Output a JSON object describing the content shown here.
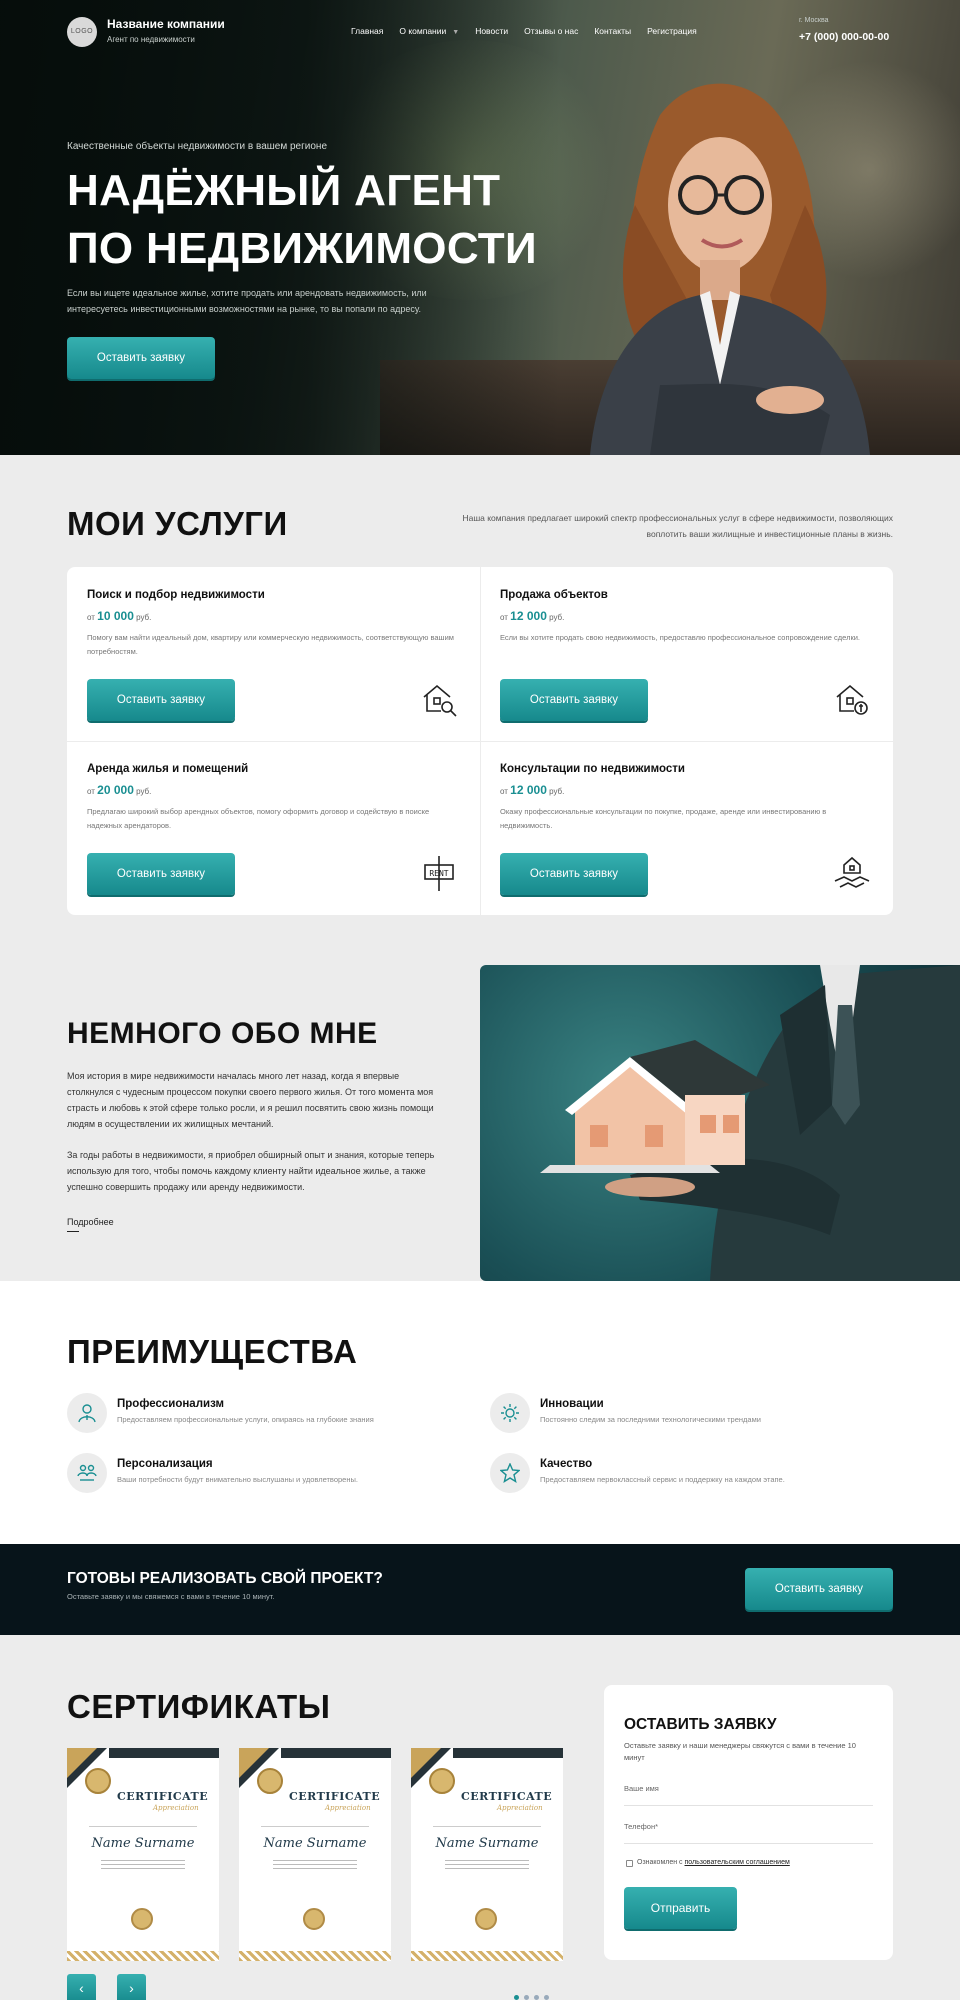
{
  "header": {
    "logo_text": "LOGO",
    "company_name": "Название компании",
    "company_sub": "Агент по недвижимости",
    "nav": [
      "Главная",
      "О компании",
      "Новости",
      "Отзывы о нас",
      "Контакты",
      "Регистрация"
    ],
    "city": "г. Москва",
    "phone": "+7 (000) 000-00-00"
  },
  "hero": {
    "kicker": "Качественные объекты недвижимости в вашем регионе",
    "title_line1": "НАДЁЖНЫЙ АГЕНТ",
    "title_line2": "ПО НЕДВИЖИМОСТИ",
    "description": "Если вы ищете идеальное жилье, хотите продать или арендовать недвижимость, или интересуетесь инвестиционными возможностями на рынке, то вы попали по адресу.",
    "button": "Оставить заявку"
  },
  "services": {
    "title": "МОИ УСЛУГИ",
    "intro": "Наша компания предлагает широкий спектр профессиональных услуг в сфере недвижимости, позволяющих воплотить ваши жилищные и инвестиционные планы в жизнь.",
    "price_prefix": "от",
    "currency": "руб.",
    "button": "Оставить заявку",
    "items": [
      {
        "title": "Поиск и подбор недвижимости",
        "price": "10 000",
        "desc": "Помогу вам найти идеальный дом, квартиру или коммерческую недвижимость, соответствующую вашим потребностям.",
        "icon": "house-search-icon"
      },
      {
        "title": "Продажа объектов",
        "price": "12 000",
        "desc": "Если вы хотите продать свою недвижимость, предоставлю профессиональное сопровождение сделки.",
        "icon": "house-money-icon"
      },
      {
        "title": "Аренда жилья и помещений",
        "price": "20 000",
        "desc": "Предлагаю широкий выбор арендных объектов, помогу оформить договор и содействую в поиске надежных арендаторов.",
        "icon": "rent-sign-icon",
        "icon_text": "RENT"
      },
      {
        "title": "Консультации по недвижимости",
        "price": "12 000",
        "desc": "Окажу профессиональные консультации по покупке, продаже, аренде или инвестированию в недвижимость.",
        "icon": "house-handshake-icon"
      }
    ]
  },
  "about": {
    "title": "НЕМНОГО ОБО МНЕ",
    "p1": "Моя история в мире недвижимости началась много лет назад, когда я впервые столкнулся с чудесным процессом покупки своего первого жилья. От того момента моя страсть и любовь к этой сфере только росли, и я решил посвятить свою жизнь помощи людям в осуществлении их жилищных мечтаний.",
    "p2": "За годы работы в недвижимости, я приобрел обширный опыт и знания, которые теперь использую для того, чтобы помочь каждому клиенту найти идеальное жилье, а также успешно совершить продажу или аренду недвижимости.",
    "more": "Подробнее"
  },
  "advantages": {
    "title": "ПРЕИМУЩЕСТВА",
    "items": [
      {
        "title": "Профессионализм",
        "desc": "Предоставляем профессиональные услуги, опираясь на глубокие знания",
        "icon": "professional-icon"
      },
      {
        "title": "Инновации",
        "desc": "Постоянно следим за последними технологическими трендами",
        "icon": "gear-icon"
      },
      {
        "title": "Персонализация",
        "desc": "Ваши потребности будут внимательно выслушаны и удовлетворены.",
        "icon": "hands-people-icon"
      },
      {
        "title": "Качество",
        "desc": "Предоставляем первоклассный сервис и поддержку на каждом этапе.",
        "icon": "star-icon"
      }
    ]
  },
  "cta": {
    "title": "ГОТОВЫ РЕАЛИЗОВАТЬ СВОЙ ПРОЕКТ?",
    "subtitle": "Оставьте заявку и мы свяжемся с вами в течение 10 минут.",
    "button": "Оставить заявку"
  },
  "certificates": {
    "title": "СЕРТИФИКАТЫ",
    "cert_heading": "CERTIFICATE",
    "cert_sub": "Appreciation",
    "cert_name": "Name Surname",
    "count": 3,
    "prev": "‹",
    "next": "›"
  },
  "form": {
    "title": "ОСТАВИТЬ ЗАЯВКУ",
    "subtitle": "Оставьте заявку и наши менеджеры свяжутся с вами в течение 10 минут",
    "name_placeholder": "Ваше имя",
    "phone_placeholder": "Телефон*",
    "agree_text": "Ознакомлен с",
    "agree_link": "пользовательским соглашением",
    "submit": "Отправить"
  }
}
